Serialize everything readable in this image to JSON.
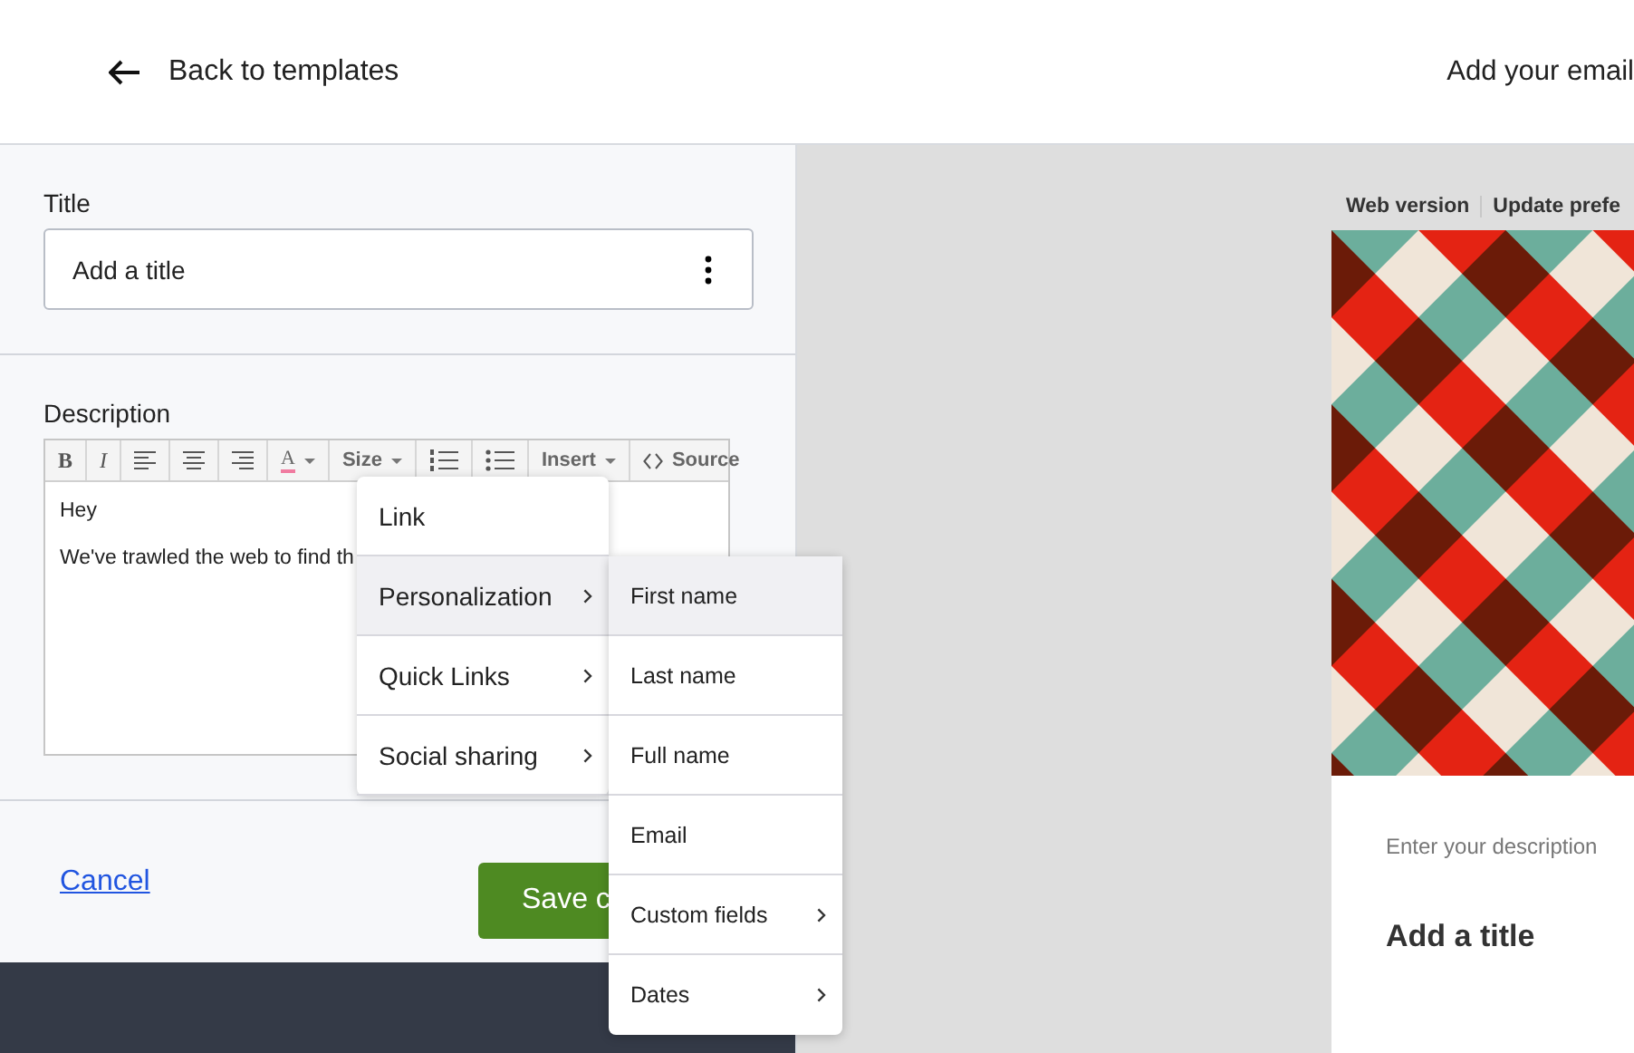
{
  "header": {
    "back_label": "Back to templates",
    "right_text": "Add your email"
  },
  "form": {
    "title_label": "Title",
    "title_value": "Add a title",
    "description_label": "Description",
    "toolbar": [
      {
        "kind": "bold",
        "label": "B"
      },
      {
        "kind": "italic",
        "label": "I"
      },
      {
        "kind": "align-left"
      },
      {
        "kind": "align-center"
      },
      {
        "kind": "align-right"
      },
      {
        "kind": "color",
        "label": "A"
      },
      {
        "kind": "dropdown",
        "label": "Size"
      },
      {
        "kind": "ordered-list"
      },
      {
        "kind": "bullet-list"
      },
      {
        "kind": "dropdown",
        "label": "Insert"
      },
      {
        "kind": "source",
        "label": "Source"
      }
    ],
    "editor_lines": [
      "Hey",
      "We've trawled the web to find th"
    ],
    "insert_menu": [
      {
        "label": "Link",
        "submenu": false,
        "selected": false
      },
      {
        "label": "Personalization",
        "submenu": true,
        "selected": true
      },
      {
        "label": "Quick Links",
        "submenu": true,
        "selected": false
      },
      {
        "label": "Social sharing",
        "submenu": true,
        "selected": false
      }
    ],
    "personalization_menu": [
      {
        "label": "First name",
        "submenu": false,
        "selected": true
      },
      {
        "label": "Last name",
        "submenu": false,
        "selected": false
      },
      {
        "label": "Full name",
        "submenu": false,
        "selected": false
      },
      {
        "label": "Email",
        "submenu": false,
        "selected": false
      },
      {
        "label": "Custom fields",
        "submenu": true,
        "selected": false
      },
      {
        "label": "Dates",
        "submenu": true,
        "selected": false
      }
    ],
    "cancel_label": "Cancel",
    "save_label": "Save c"
  },
  "preview": {
    "links": [
      "Web version",
      "Update prefe"
    ],
    "description": "Enter your description",
    "title": "Add a title"
  }
}
